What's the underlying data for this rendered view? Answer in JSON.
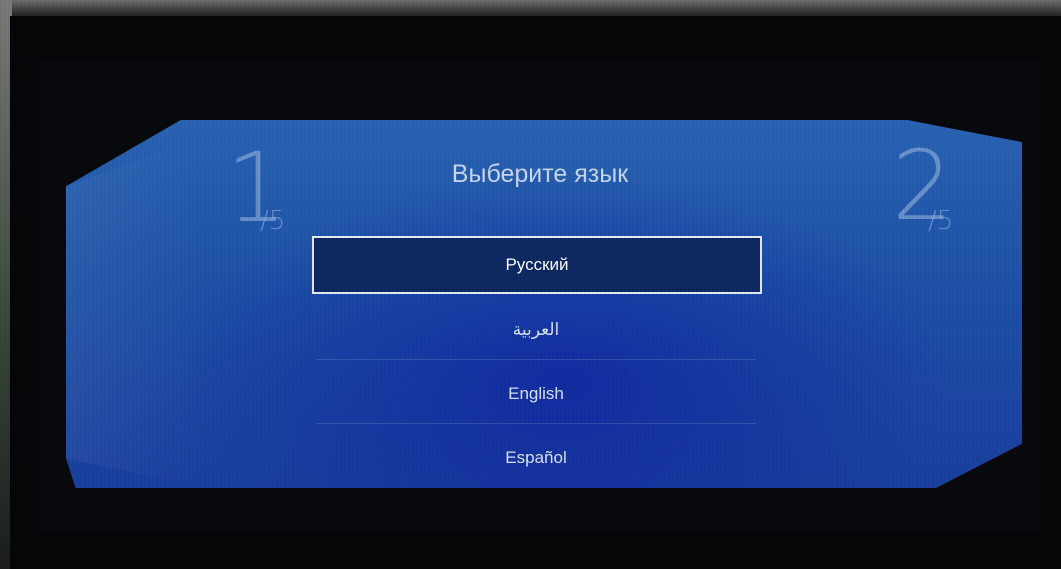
{
  "setup": {
    "title": "Выберите язык",
    "current_step": "1",
    "current_step_total": "/5",
    "next_step": "2",
    "next_step_total": "/5"
  },
  "languages": [
    {
      "label": "Русский",
      "selected": true
    },
    {
      "label": "العربية",
      "selected": false
    },
    {
      "label": "English",
      "selected": false
    },
    {
      "label": "Español",
      "selected": false
    }
  ],
  "colors": {
    "panel": "#1e52a8",
    "selected_bg": "#0e2a62",
    "selected_border": "#e6edf7"
  }
}
